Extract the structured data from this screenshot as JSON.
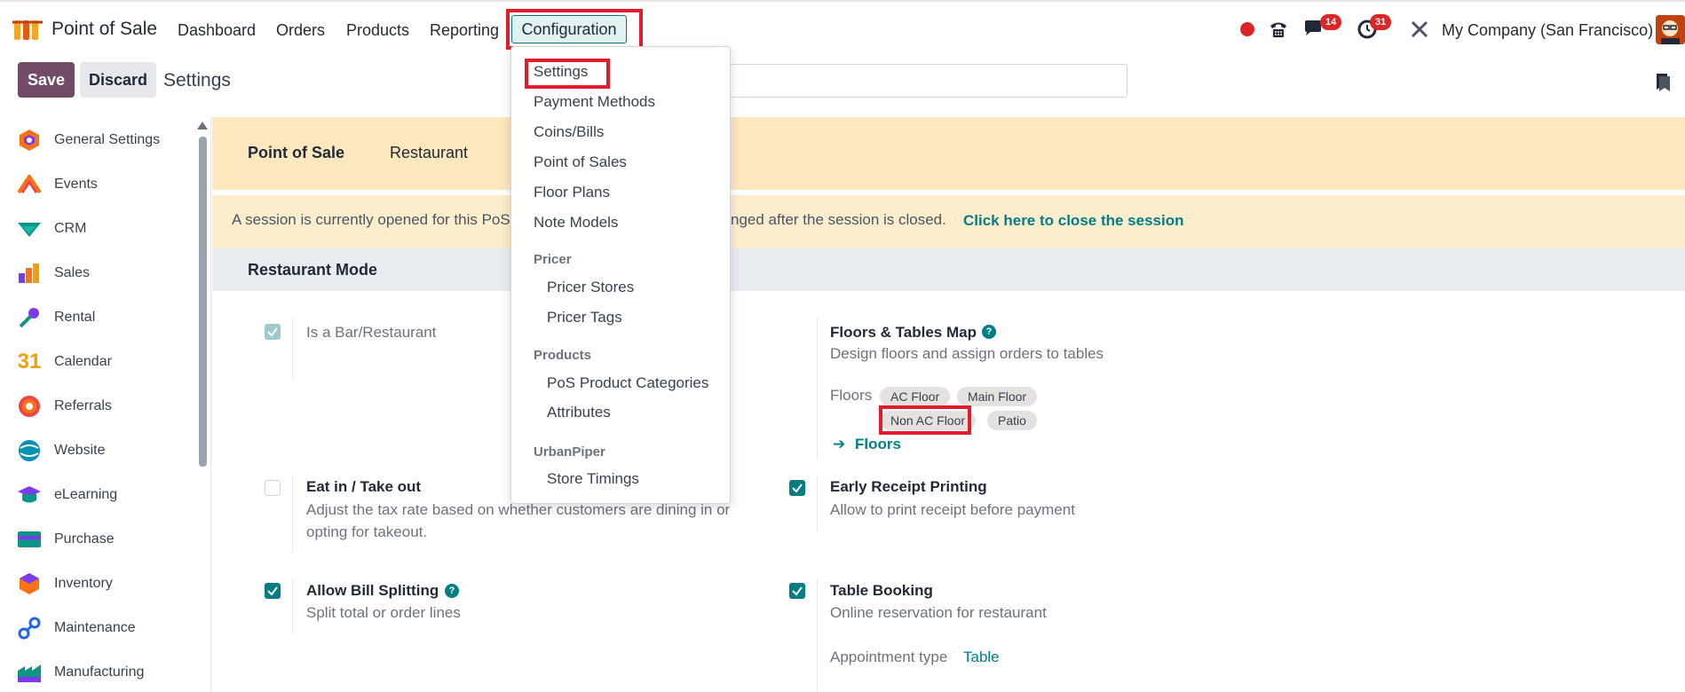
{
  "navbar": {
    "app_name": "Point of Sale",
    "menus": [
      "Dashboard",
      "Orders",
      "Products",
      "Reporting",
      "Configuration"
    ],
    "messages_badge": "14",
    "activities_badge": "31",
    "company": "My Company (San Francisco)"
  },
  "control_panel": {
    "save_label": "Save",
    "discard_label": "Discard",
    "title": "Settings"
  },
  "sidebar": {
    "items": [
      {
        "label": "General Settings",
        "icon": "general-settings-icon"
      },
      {
        "label": "Events",
        "icon": "events-icon"
      },
      {
        "label": "CRM",
        "icon": "crm-icon"
      },
      {
        "label": "Sales",
        "icon": "sales-icon"
      },
      {
        "label": "Rental",
        "icon": "rental-icon"
      },
      {
        "label": "Calendar",
        "icon": "calendar-icon"
      },
      {
        "label": "Referrals",
        "icon": "referrals-icon"
      },
      {
        "label": "Website",
        "icon": "website-icon"
      },
      {
        "label": "eLearning",
        "icon": "elearning-icon"
      },
      {
        "label": "Purchase",
        "icon": "purchase-icon"
      },
      {
        "label": "Inventory",
        "icon": "inventory-icon"
      },
      {
        "label": "Maintenance",
        "icon": "maintenance-icon"
      },
      {
        "label": "Manufacturing",
        "icon": "manufacturing-icon"
      }
    ],
    "calendar_glyph": "31"
  },
  "tabs": [
    "Point of Sale",
    "Restaurant"
  ],
  "alert": {
    "text_start": "A session is currently opened for this PoS",
    "text_end": "nged after the session is closed.",
    "link": "Click here to close the session"
  },
  "section": {
    "title": "Restaurant Mode"
  },
  "settings": {
    "bar_restaurant": {
      "label": "Is a Bar/Restaurant",
      "checked": true
    },
    "floors_map": {
      "title": "Floors & Tables Map",
      "desc": "Design floors and assign orders to tables",
      "floors_label": "Floors",
      "tags": [
        "AC Floor",
        "Main Floor",
        "Non AC Floor",
        "Patio"
      ],
      "link": "Floors"
    },
    "eat_in": {
      "title": "Eat in / Take out",
      "desc_line1": "Adjust the tax rate based on whether customers are dining in or",
      "desc_line2": "opting for takeout.",
      "checked": false
    },
    "early_receipt": {
      "title": "Early Receipt Printing",
      "desc": "Allow to print receipt before payment",
      "checked": true
    },
    "bill_splitting": {
      "title": "Allow Bill Splitting",
      "desc": "Split total or order lines",
      "checked": true
    },
    "table_booking": {
      "title": "Table Booking",
      "desc": "Online reservation for restaurant",
      "appointment_label": "Appointment type",
      "appointment_value": "Table",
      "checked": true
    }
  },
  "dropdown": {
    "items": [
      "Settings",
      "Payment Methods",
      "Coins/Bills",
      "Point of Sales",
      "Floor Plans",
      "Note Models"
    ],
    "groups": [
      {
        "header": "Pricer",
        "items": [
          "Pricer Stores",
          "Pricer Tags"
        ]
      },
      {
        "header": "Products",
        "items": [
          "PoS Product Categories",
          "Attributes"
        ]
      },
      {
        "header": "UrbanPiper",
        "items": [
          "Store Timings"
        ]
      }
    ]
  },
  "colors": {
    "brand": "#714b67",
    "accent": "#017e84",
    "highlight_box": "#e11d2b"
  }
}
